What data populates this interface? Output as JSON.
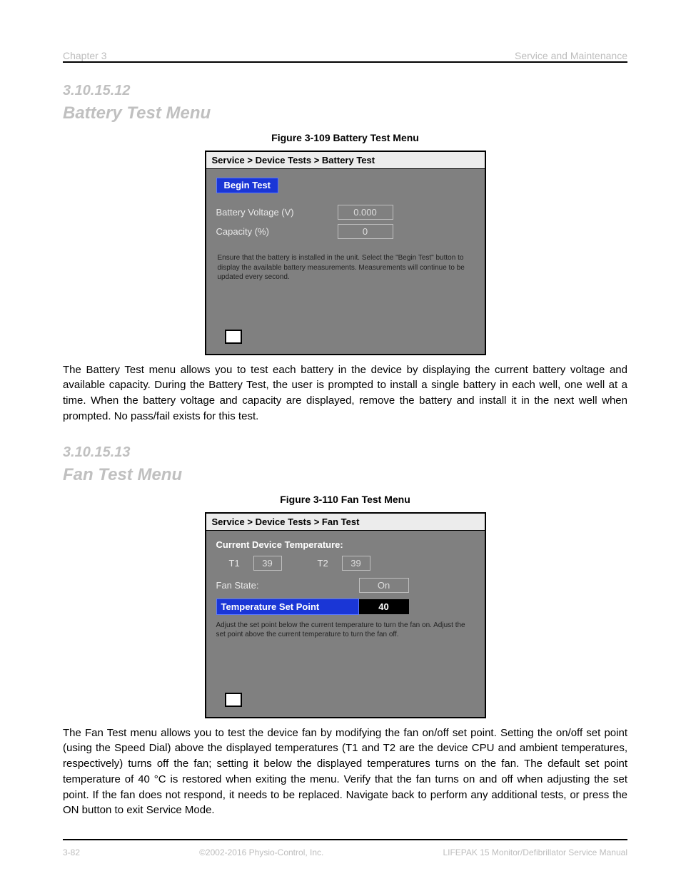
{
  "page_header": {
    "left": "Chapter 3",
    "right": "Service and Maintenance"
  },
  "page_footer": {
    "left": "3-82",
    "center": "©2002-2016 Physio-Control, Inc.",
    "right": "LIFEPAK 15 Monitor/Defibrillator Service Manual"
  },
  "battery": {
    "section_num": "3.10.15.12",
    "section_title": "Battery Test Menu",
    "figure_caption": "Figure 3-109  Battery Test Menu",
    "titlebar": "Service > Device Tests > Battery Test",
    "begin_label": "Begin Test",
    "voltage_label": "Battery Voltage (V)",
    "voltage_value": "0.000",
    "capacity_label": "Capacity (%)",
    "capacity_value": "0",
    "instructions": "Ensure that the battery is installed in the unit.  Select the \"Begin Test\" button to display the available battery measurements.  Measurements will continue to be updated every second.",
    "back": "←",
    "desc": "The Battery Test menu allows you to test each battery in the device by displaying the current battery voltage and available capacity.  During the Battery Test, the user is prompted to install a single battery in each well, one well at a time.  When the battery voltage and capacity are displayed, remove the battery and install it in the next well when prompted.  No pass/fail exists for this test."
  },
  "fan": {
    "section_num": "3.10.15.13",
    "section_title": "Fan Test Menu",
    "figure_caption": "Figure 3-110  Fan Test Menu",
    "titlebar": "Service > Device Tests > Fan Test",
    "temp_header": "Current Device Temperature:",
    "t1_label": "T1",
    "t1_val": "39",
    "t2_label": "T2",
    "t2_val": "39",
    "fanstate_label": "Fan State:",
    "fanstate_val": "On",
    "setpoint_label": "Temperature Set Point",
    "setpoint_val": "40",
    "instructions": "Adjust the set point below the current temperature to turn the fan on.  Adjust the set point above the current temperature to turn the fan off.",
    "back": "←",
    "desc": "The Fan Test menu allows you to test the device fan by modifying the fan on/off set point.  Setting the on/off set point (using the Speed Dial) above the displayed temperatures (T1 and T2 are the device CPU and ambient temperatures, respectively) turns off the fan; setting it below the displayed temperatures turns on the fan.  The default set point temperature of 40 °C is restored when exiting the menu.  Verify that the fan turns on and off when adjusting the set point.  If the fan does not respond, it needs to be replaced.  Navigate back to perform any additional tests, or press the ON button to exit Service Mode."
  }
}
